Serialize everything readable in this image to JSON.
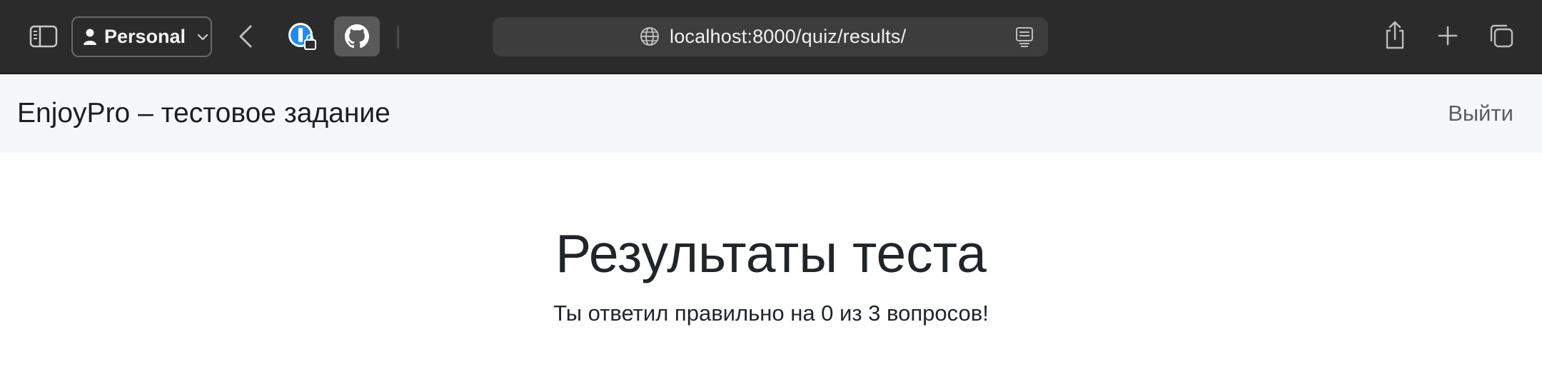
{
  "browser": {
    "profile_label": "Personal",
    "url": "localhost:8000/quiz/results/"
  },
  "navbar": {
    "brand": "EnjoyPro – тестовое задание",
    "logout": "Выйти"
  },
  "main": {
    "title": "Результаты теста",
    "result_text": "Ты ответил правильно на 0 из 3 вопросов!"
  },
  "icons": {
    "sidebar": "sidebar-icon",
    "profile": "person-icon",
    "back": "chevron-left-icon",
    "password_manager": "1password-icon",
    "github": "github-icon",
    "site": "globe-icon",
    "reader": "reader-icon",
    "share": "share-icon",
    "new_tab": "plus-icon",
    "tabs": "tabs-overview-icon"
  }
}
